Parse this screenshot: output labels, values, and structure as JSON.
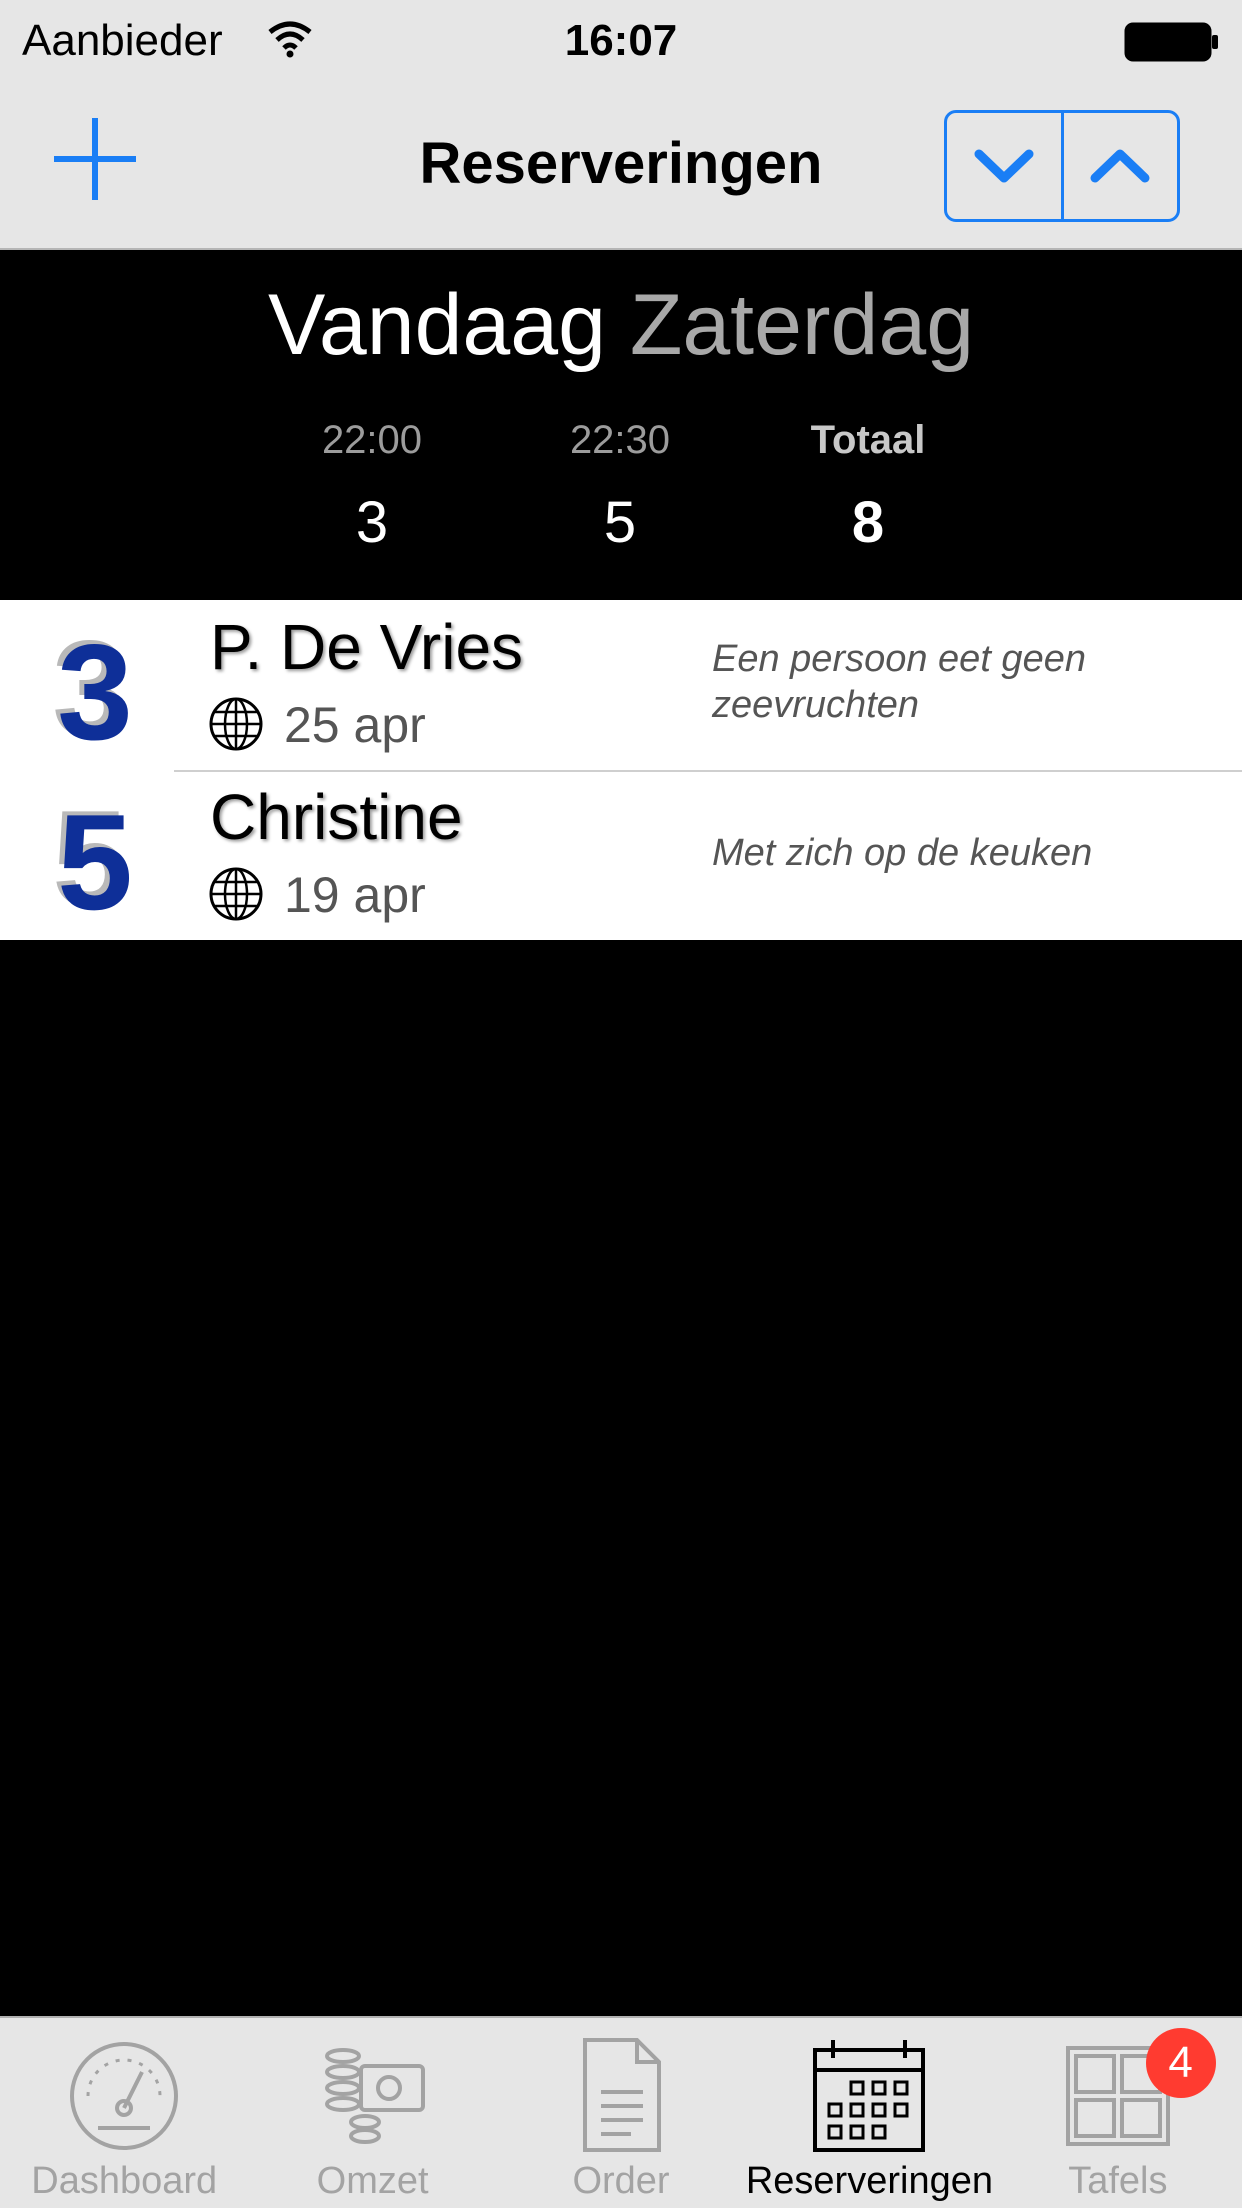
{
  "status_bar": {
    "carrier": "Aanbieder",
    "time": "16:07"
  },
  "nav": {
    "title": "Reserveringen",
    "accent_color": "#1a7ef5"
  },
  "summary": {
    "today_label": "Vandaag",
    "day_name": "Zaterdag",
    "slots": [
      {
        "time": "22:00",
        "count": "3"
      },
      {
        "time": "22:30",
        "count": "5"
      },
      {
        "time": "Totaal",
        "count": "8"
      }
    ]
  },
  "reservations": [
    {
      "guests": "3",
      "name": "P. De Vries",
      "date": "25 apr",
      "note": "Een persoon eet geen zeevruchten",
      "source_icon": "globe-icon"
    },
    {
      "guests": "5",
      "name": "Christine",
      "date": "19 apr",
      "note": "Met zich op de keuken",
      "source_icon": "globe-icon"
    }
  ],
  "tabs": [
    {
      "label": "Dashboard",
      "icon": "speedometer-icon"
    },
    {
      "label": "Omzet",
      "icon": "coins-icon"
    },
    {
      "label": "Order",
      "icon": "document-icon"
    },
    {
      "label": "Reserveringen",
      "icon": "calendar-icon",
      "active": true
    },
    {
      "label": "Tafels",
      "icon": "tables-icon",
      "badge": "4"
    }
  ],
  "colors": {
    "guest_count": "#0e2f98",
    "badge": "#ff3b30",
    "bar_background": "#e6e6e6"
  }
}
